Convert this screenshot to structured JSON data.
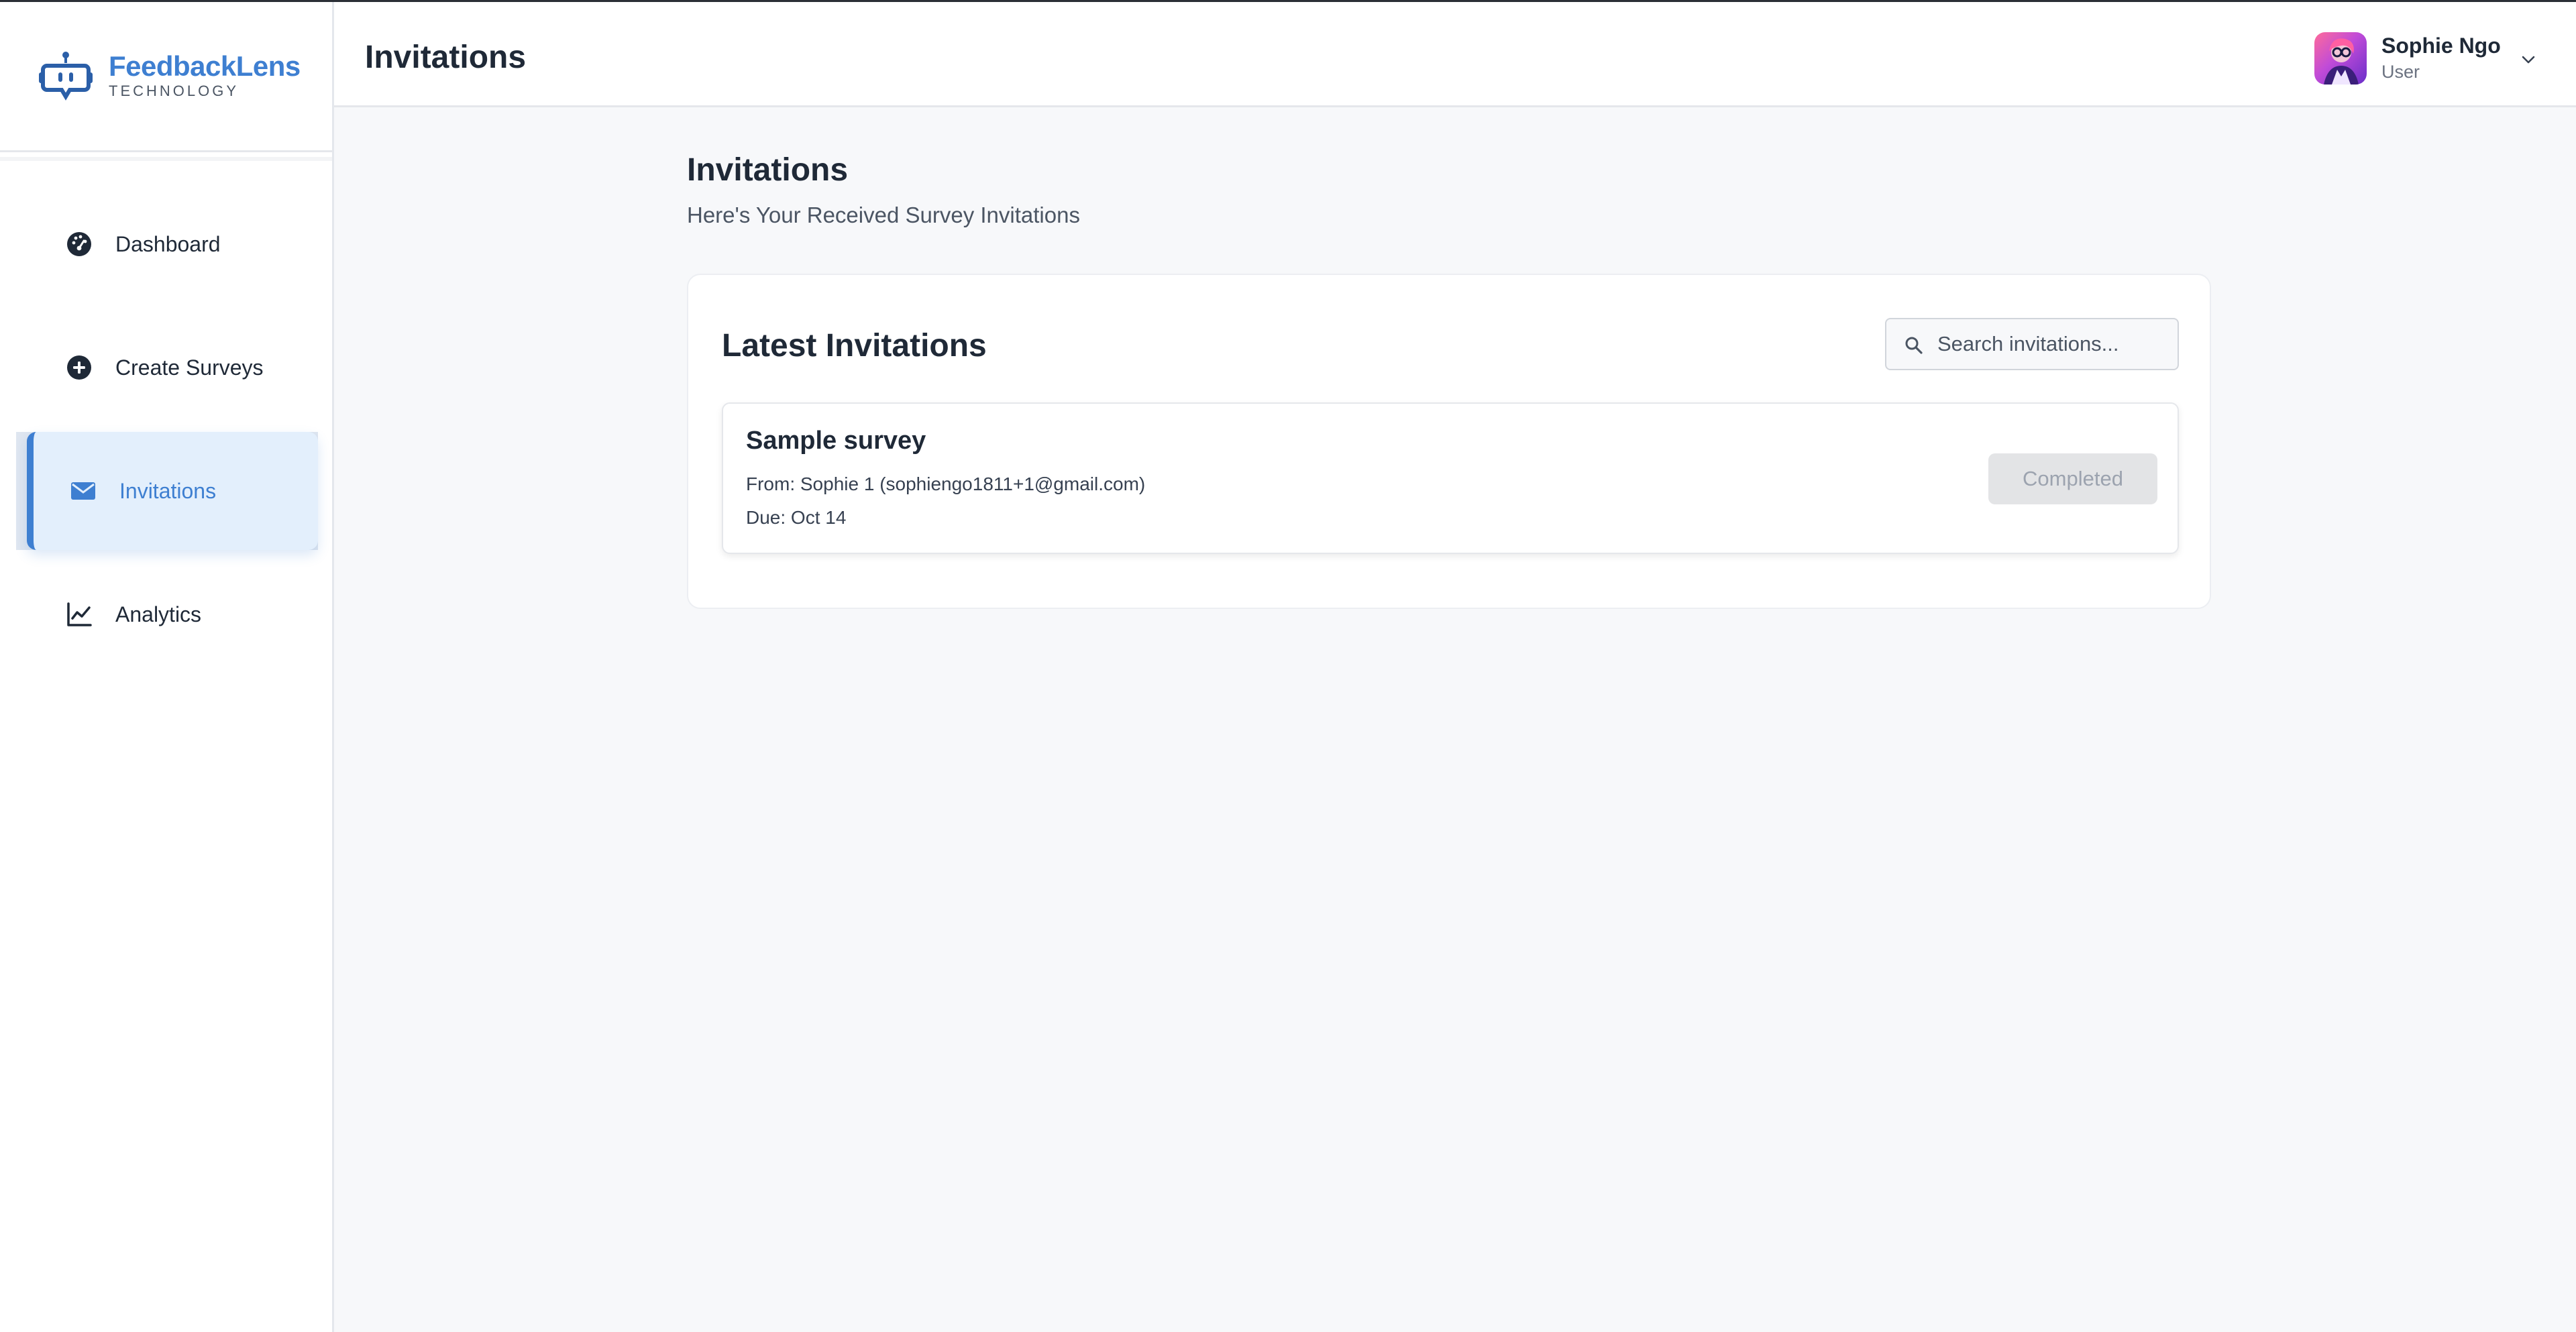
{
  "app": {
    "brand_name": "FeedbackLens",
    "brand_sub": "TECHNOLOGY",
    "accent_color": "#3e7fd1"
  },
  "sidebar": {
    "items": [
      {
        "label": "Dashboard",
        "icon": "gauge-icon",
        "active": false
      },
      {
        "label": "Create Surveys",
        "icon": "plus-circle-icon",
        "active": false
      },
      {
        "label": "Invitations",
        "icon": "envelope-icon",
        "active": true
      },
      {
        "label": "Analytics",
        "icon": "line-chart-icon",
        "active": false
      }
    ]
  },
  "header": {
    "title": "Invitations",
    "user": {
      "name": "Sophie Ngo",
      "role": "User"
    }
  },
  "main": {
    "title": "Invitations",
    "subtitle": "Here's Your Received Survey Invitations",
    "panel": {
      "title": "Latest Invitations",
      "search_placeholder": "Search invitations...",
      "invitations": [
        {
          "title": "Sample survey",
          "from": "From: Sophie 1 (sophiengo1811+1@gmail.com)",
          "due": "Due: Oct 14",
          "status": "Completed"
        }
      ]
    }
  }
}
